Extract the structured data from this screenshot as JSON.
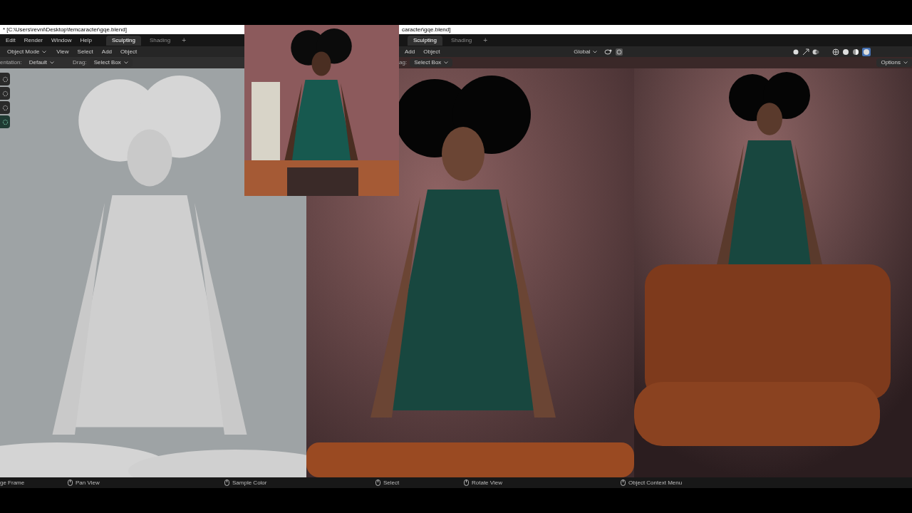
{
  "left_window": {
    "title": "* [C:\\Users\\revni\\Desktop\\femcaracter\\gqe.blend]",
    "menu": [
      "Edit",
      "Render",
      "Window",
      "Help"
    ],
    "workspace_tabs": [
      {
        "label": "Sculpting",
        "selected": true
      },
      {
        "label": "Shading",
        "selected": false
      }
    ],
    "add_tab": "+",
    "mode": "Object Mode",
    "header_menu": [
      "View",
      "Select",
      "Add",
      "Object"
    ],
    "orientation_label": "entation:",
    "orientation": "Default",
    "drag_label": "Drag:",
    "drag": "Select Box",
    "tools": [
      {
        "selected": false
      },
      {
        "selected": false
      },
      {
        "selected": false
      },
      {
        "selected": true
      }
    ]
  },
  "right_window": {
    "title": "caracter\\gqe.blend]",
    "workspace_tabs": [
      {
        "label": "Sculpting",
        "selected": true
      },
      {
        "label": "Shading",
        "selected": false
      }
    ],
    "add_tab": "+",
    "header_menu": [
      "Add",
      "Object"
    ],
    "transform": "Global",
    "drag_label": "ag:",
    "drag": "Select Box",
    "options": "Options"
  },
  "status_bar": [
    "ge Frame",
    "Pan View",
    "Sample Color",
    "Select",
    "Rotate View",
    "Object Context Menu"
  ]
}
